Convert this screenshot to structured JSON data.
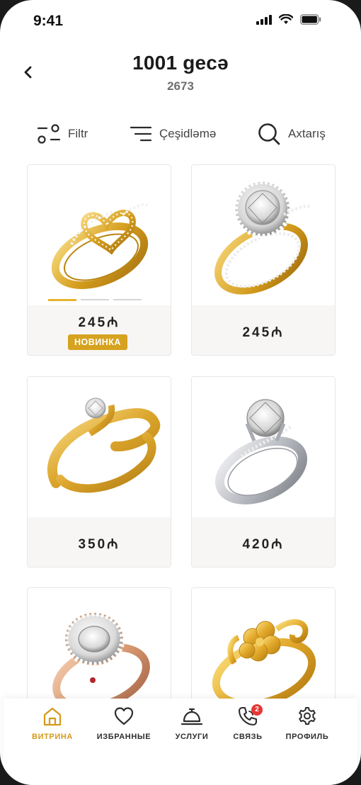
{
  "status_bar": {
    "time": "9:41"
  },
  "header": {
    "title": "1001 gecə",
    "subtitle": "2673"
  },
  "toolbar": {
    "filter": "Filtr",
    "sort": "Çeşidləmə",
    "search": "Axtarış"
  },
  "products": [
    {
      "price": "245₼",
      "badge": "НОВИНКА",
      "image": "gold-heart-ring"
    },
    {
      "price": "245₼",
      "image": "gold-halo-ring"
    },
    {
      "price": "350₼",
      "image": "gold-solitaire-bypass-ring"
    },
    {
      "price": "420₼",
      "image": "white-gold-solitaire-ring"
    },
    {
      "price": "",
      "image": "rose-gold-oval-halo-ring"
    },
    {
      "price": "",
      "image": "gold-flower-ring"
    }
  ],
  "nav": {
    "items": [
      {
        "label": "ВИТРИНА",
        "icon": "home-icon",
        "active": true
      },
      {
        "label": "ИЗБРАННЫЕ",
        "icon": "heart-icon"
      },
      {
        "label": "УСЛУГИ",
        "icon": "service-bell-icon"
      },
      {
        "label": "СВЯЗЬ",
        "icon": "phone-icon",
        "badge": "2"
      },
      {
        "label": "ПРОФИЛЬ",
        "icon": "gear-icon"
      }
    ]
  },
  "colors": {
    "accent": "#d6a21f",
    "gold": "#e5b32c",
    "badge_red": "#e53935"
  }
}
